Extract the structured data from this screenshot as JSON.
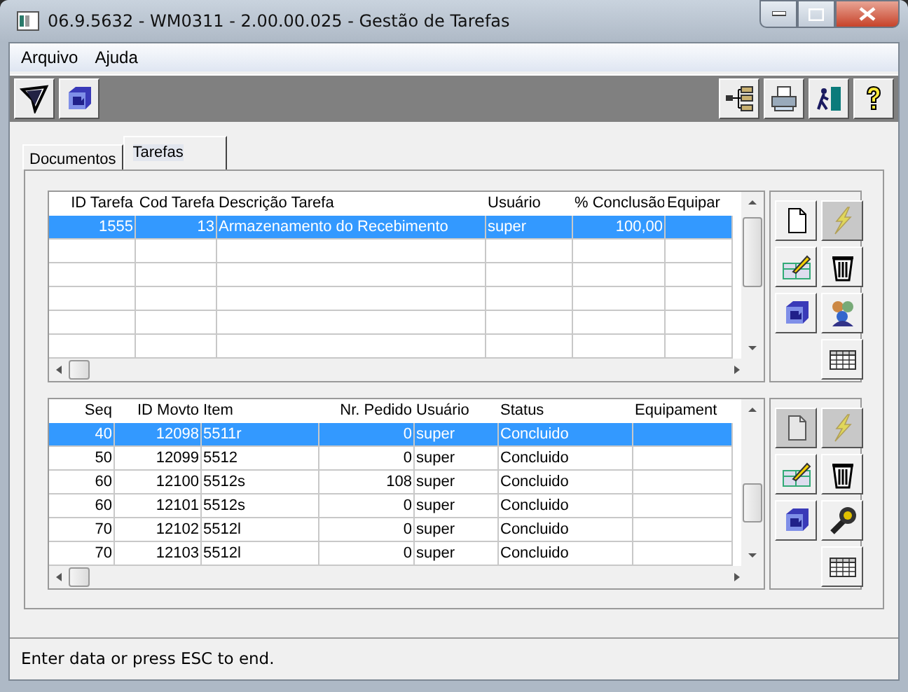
{
  "window": {
    "title": "06.9.5632 - WM0311 - 2.00.00.025 - Gestão de Tarefas"
  },
  "menu": [
    "Arquivo",
    "Ajuda"
  ],
  "toolbar_left": [
    {
      "kind": "filter"
    },
    {
      "kind": "import"
    }
  ],
  "toolbar_right": [
    {
      "kind": "tree"
    },
    {
      "kind": "print"
    },
    {
      "kind": "exit"
    },
    {
      "kind": "help"
    }
  ],
  "tabs": [
    {
      "label": "Documentos",
      "selected": false
    },
    {
      "label": "Tarefas",
      "selected": true
    }
  ],
  "tasks_table": {
    "columns": [
      "ID Tarefa",
      "Cod Tarefa",
      "Descrição Tarefa",
      "Usuário",
      "% Conclusão",
      "Equipar"
    ],
    "rows": [
      {
        "cells": [
          "1555",
          "13",
          "Armazenamento do Recebimento",
          "super",
          "100,00",
          ""
        ],
        "selected": true
      }
    ]
  },
  "tasks_buttons": [
    {
      "kind": "new",
      "disabled": false
    },
    {
      "kind": "execute",
      "disabled": true
    },
    {
      "kind": "edit",
      "disabled": false
    },
    {
      "kind": "delete",
      "disabled": false
    },
    {
      "kind": "import",
      "disabled": false
    },
    {
      "kind": "group",
      "disabled": false
    },
    {
      "kind": "grid",
      "disabled": false
    }
  ],
  "moves_table": {
    "columns": [
      "Seq",
      "ID Movto",
      "Item",
      "Nr. Pedido",
      "Usuário",
      "Status",
      "Equipament"
    ],
    "rows": [
      {
        "cells": [
          "40",
          "12098",
          "5511r",
          "0",
          "super",
          "Concluido",
          ""
        ],
        "selected": true
      },
      {
        "cells": [
          "50",
          "12099",
          "5512",
          "0",
          "super",
          "Concluido",
          ""
        ],
        "selected": false
      },
      {
        "cells": [
          "60",
          "12100",
          "5512s",
          "108",
          "super",
          "Concluido",
          ""
        ],
        "selected": false
      },
      {
        "cells": [
          "60",
          "12101",
          "5512s",
          "0",
          "super",
          "Concluido",
          ""
        ],
        "selected": false
      },
      {
        "cells": [
          "70",
          "12102",
          "5512l",
          "0",
          "super",
          "Concluido",
          ""
        ],
        "selected": false
      },
      {
        "cells": [
          "70",
          "12103",
          "5512l",
          "0",
          "super",
          "Concluido",
          ""
        ],
        "selected": false
      }
    ]
  },
  "moves_buttons": [
    {
      "kind": "new",
      "disabled": true
    },
    {
      "kind": "execute",
      "disabled": true
    },
    {
      "kind": "edit",
      "disabled": false
    },
    {
      "kind": "delete",
      "disabled": false
    },
    {
      "kind": "import",
      "disabled": false
    },
    {
      "kind": "tools",
      "disabled": false
    },
    {
      "kind": "grid",
      "disabled": false
    }
  ],
  "status_bar": "Enter data or press ESC to end."
}
